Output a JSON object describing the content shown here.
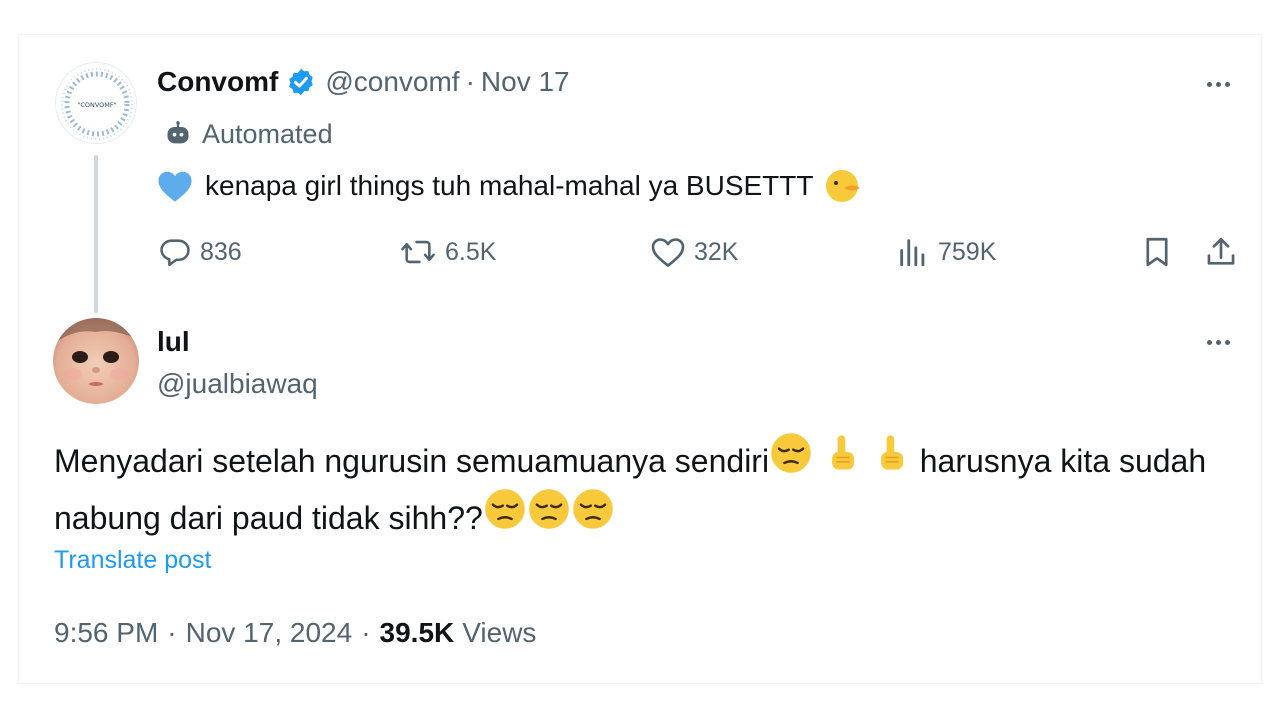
{
  "parent_tweet": {
    "display_name": "Convomf",
    "handle": "@convomf",
    "separator": "·",
    "date": "Nov 17",
    "avatar_text": "\"CONVOMF\"",
    "automated_label": "Automated",
    "text": "kenapa girl things tuh mahal-mahal ya BUSETTT",
    "actions": {
      "replies": "836",
      "reposts": "6.5K",
      "likes": "32K",
      "views": "759K"
    }
  },
  "reply_tweet": {
    "display_name": "lul",
    "handle": "@jualbiawaq",
    "text_part1": "Menyadari setelah ngurusin semuamuanya sendiri",
    "text_part2": " harusnya kita sudah nabung dari paud tidak sihh??",
    "translate_label": "Translate post",
    "time": "9:56 PM",
    "separator": "·",
    "date": "Nov 17, 2024",
    "views_count": "39.5K",
    "views_label": "Views"
  },
  "colors": {
    "text_primary": "#0f1419",
    "text_secondary": "#536471",
    "link": "#1d9bf0",
    "verified": "#1d9bf0",
    "thread_line": "#cfd9de"
  }
}
